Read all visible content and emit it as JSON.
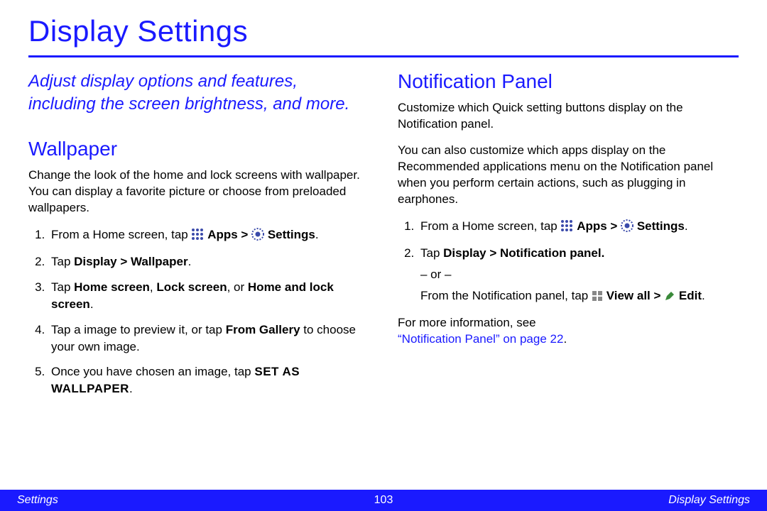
{
  "title": "Display Settings",
  "intro": "Adjust display options and features, including the screen brightness, and more.",
  "wallpaper": {
    "heading": "Wallpaper",
    "desc": "Change the look of the home and lock screens with wallpaper. You can display a favorite picture or choose from preloaded wallpapers.",
    "step1_pre": "From a Home screen, tap ",
    "step1_apps": "Apps",
    "step1_gt": " > ",
    "step1_settings": "Settings",
    "step1_dot": ".",
    "step2_pre": "Tap ",
    "step2_bold": "Display > Wallpaper",
    "step2_dot": ".",
    "step3_pre": "Tap ",
    "step3_b1": "Home screen",
    "step3_c1": ", ",
    "step3_b2": "Lock screen",
    "step3_c2": ", or ",
    "step3_b3": "Home and lock screen",
    "step3_dot": ".",
    "step4_pre": "Tap a image to preview it, or tap ",
    "step4_bold": "From Gallery",
    "step4_post": " to choose your own image.",
    "step5_pre": " Once you have chosen an image, tap ",
    "step5_bold": "SET AS WALLPAPER",
    "step5_dot": "."
  },
  "notif": {
    "heading": "Notification Panel",
    "p1": "Customize which Quick setting buttons display on the Notification panel.",
    "p2": "You can also customize which apps display on the Recommended applications menu on the Notification panel when you perform certain actions, such as plugging in earphones.",
    "step1_pre": "From a Home screen, tap ",
    "step1_apps": "Apps",
    "step1_gt": " > ",
    "step1_settings": "Settings",
    "step1_dot": ".",
    "step2_pre": "Tap ",
    "step2_bold": "Display > Notification panel.",
    "or": "– or –",
    "alt_pre": "From the Notification panel, tap ",
    "alt_viewall": "View all",
    "alt_gt": " > ",
    "alt_edit": "Edit",
    "alt_dot": ".",
    "more_pre": "For more information, see ",
    "more_link": "“Notification Panel” on page 22",
    "more_dot": "."
  },
  "footer": {
    "left": "Settings",
    "center": "103",
    "right": "Display Settings"
  }
}
